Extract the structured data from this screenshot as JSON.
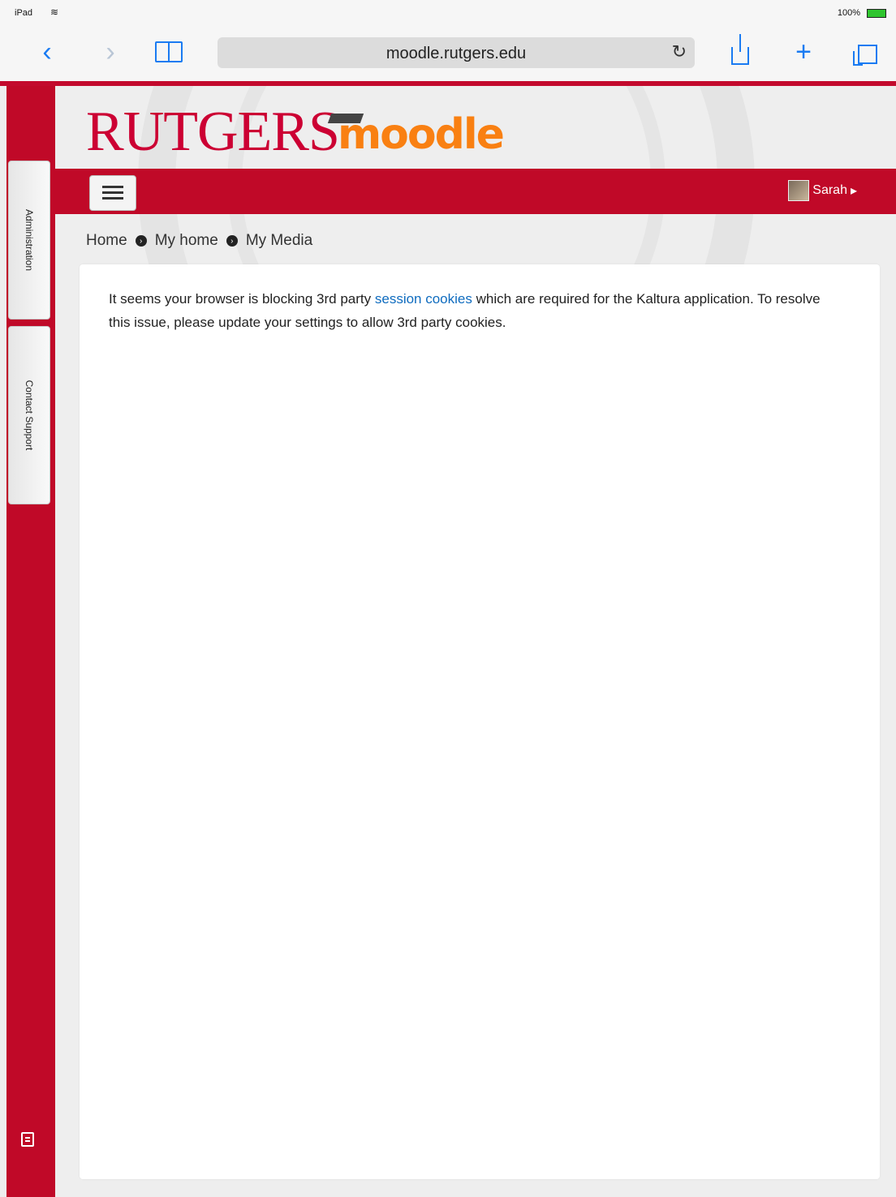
{
  "status_bar": {
    "device": "iPad",
    "battery": "100%"
  },
  "browser": {
    "url": "moodle.rutgers.edu"
  },
  "site": {
    "logo_rutgers": "RUTGERS",
    "logo_moodle": "moodle",
    "user_name": "Sarah"
  },
  "sidebar": {
    "tabs": [
      {
        "label": "Administration"
      },
      {
        "label": "Contact Support"
      }
    ]
  },
  "breadcrumb": {
    "items": [
      "Home",
      "My home",
      "My Media"
    ]
  },
  "message": {
    "before_link": "It seems your browser is blocking 3rd party ",
    "link": "session cookies",
    "after_link": " which are required for the Kaltura application. To resolve this issue, please update your settings to allow 3rd party cookies."
  },
  "colors": {
    "brand_red": "#c00928",
    "moodle_orange": "#f98012",
    "link_blue": "#0f6cbf",
    "ios_blue": "#1a7bf2"
  }
}
